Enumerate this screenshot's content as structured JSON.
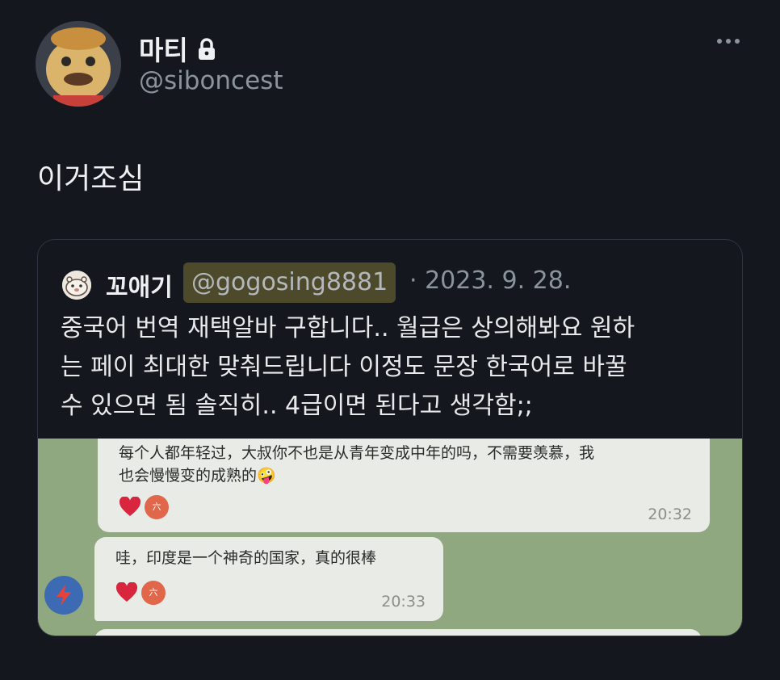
{
  "header": {
    "display_name": "마티",
    "handle": "@siboncest"
  },
  "tweet": {
    "text": "이거조심"
  },
  "quote": {
    "name": "꼬애기",
    "handle": "@gogosing8881",
    "date": "· 2023. 9. 28.",
    "lines": [
      "중국어 번역 재택알바 구합니다.. 월급은 상의해봐요 원하",
      "는 페이 최대한 맞춰드립니다 이정도 문장 한국어로 바꿀",
      "수 있으면 됨 솔직히.. 4급이면 된다고 생각함;;"
    ]
  },
  "chat": {
    "message1": {
      "line1": "每个人都年轻过，大叔你不也是从青年变成中年的吗，不需要羡慕，我",
      "line2": "也会慢慢变的成熟的🤪",
      "time": "20:32"
    },
    "message2": {
      "text": "哇，印度是一个神奇的国家，真的很棒",
      "time": "20:33"
    },
    "reaction_label": "六"
  },
  "icons": {
    "lock": "lock-icon",
    "more": "more-options-icon",
    "heart": "heart-icon"
  },
  "colors": {
    "background": "#14171e",
    "handle_highlight": "#4c4a2a",
    "chat_background": "#8fa87f",
    "heart": "#d7263d"
  }
}
